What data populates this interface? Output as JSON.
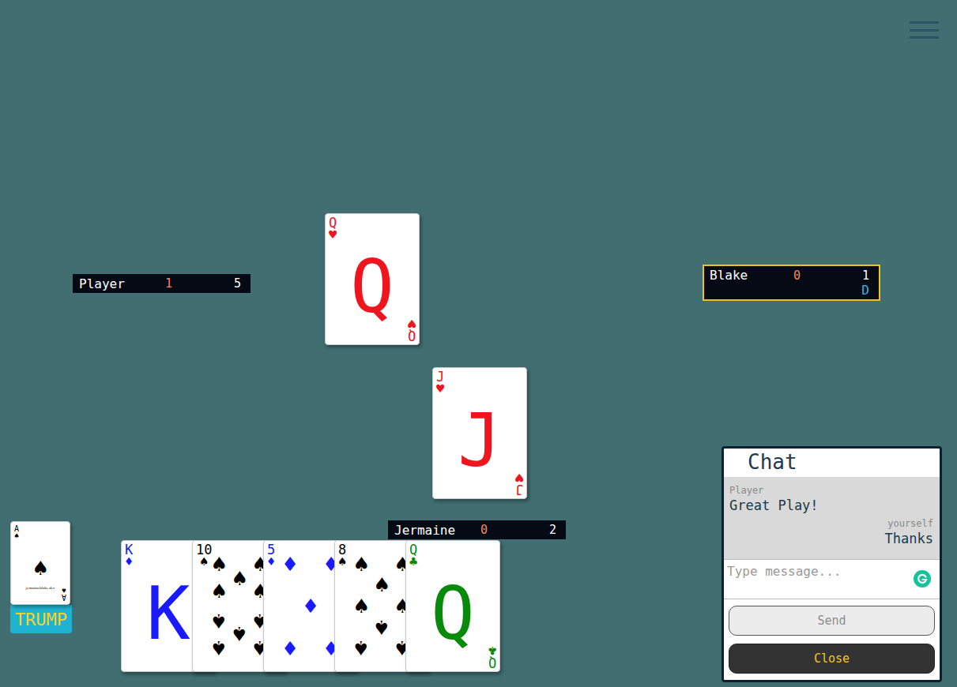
{
  "players": [
    {
      "name": "Player",
      "score": "1",
      "tricks": "5",
      "active": false,
      "dealer": false,
      "seat": "west"
    },
    {
      "name": "Blake",
      "score": "0",
      "tricks": "1",
      "active": true,
      "dealer": true,
      "seat": "east"
    },
    {
      "name": "Jermaine",
      "score": "0",
      "tricks": "2",
      "active": false,
      "dealer": false,
      "seat": "south"
    }
  ],
  "dealer_mark": "D",
  "trick": [
    {
      "rank": "Q",
      "suit": "♥",
      "color": "#f0141e",
      "seat": "west"
    },
    {
      "rank": "J",
      "suit": "♥",
      "color": "#f0141e",
      "seat": "south"
    }
  ],
  "hand": [
    {
      "rank": "K",
      "suit": "♦",
      "color": "#1a1aff"
    },
    {
      "rank": "10",
      "suit": "♠",
      "color": "#000000"
    },
    {
      "rank": "5",
      "suit": "♦",
      "color": "#1a1aff"
    },
    {
      "rank": "8",
      "suit": "♠",
      "color": "#000000"
    },
    {
      "rank": "Q",
      "suit": "♣",
      "color": "#0a8a0a"
    }
  ],
  "trump": {
    "rank": "A",
    "suit": "♠",
    "color": "#000000",
    "maker": "jermaineblake.dev",
    "label": "TRUMP"
  },
  "chat": {
    "title": "Chat",
    "messages": [
      {
        "sender": "Player",
        "text": "Great Play!",
        "own": false
      },
      {
        "sender": "yourself",
        "text": "Thanks",
        "own": true
      }
    ],
    "placeholder": "Type message...",
    "send": "Send",
    "close": "Close"
  }
}
